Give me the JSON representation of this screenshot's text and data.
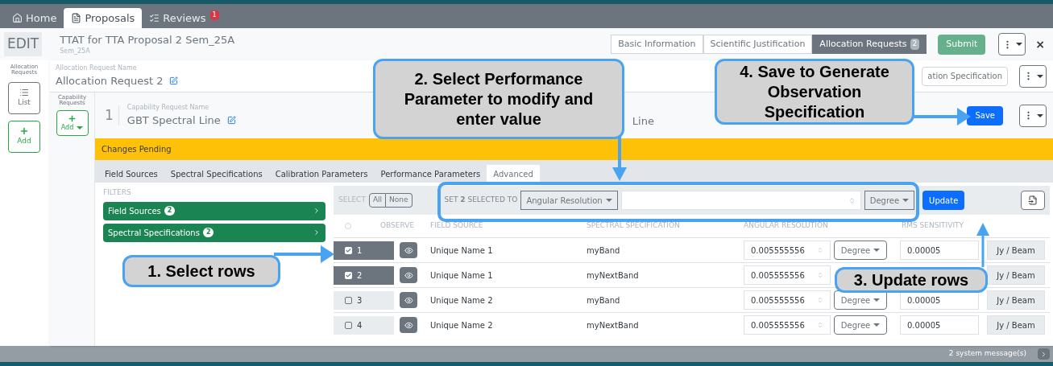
{
  "nav_tabs": [
    {
      "label": "Home",
      "kind": "home",
      "selected": false
    },
    {
      "label": "Proposals",
      "kind": "document",
      "selected": true
    },
    {
      "label": "Reviews",
      "kind": "list",
      "selected": false,
      "badge": "1"
    }
  ],
  "header": {
    "mode": "EDIT",
    "title": "TTAT for TTA Proposal 2 Sem_25A",
    "subtitle": "Sem_25A",
    "sections": [
      {
        "label": "Basic Information",
        "selected": false
      },
      {
        "label": "Scientific Justification",
        "selected": false
      },
      {
        "label": "Allocation Requests",
        "selected": true,
        "badge": "2"
      }
    ],
    "submit": "Submit",
    "close": "×"
  },
  "sidebar": {
    "heading": "Allocation Requests",
    "buttons": [
      {
        "label": "List",
        "kind": "list"
      },
      {
        "label": "Add",
        "kind": "add"
      }
    ]
  },
  "allocation": {
    "label": "Allocation Request Name",
    "value": "Allocation Request 2",
    "spec_button": "ation Specification"
  },
  "capability": {
    "heading": "Capability Requests",
    "add": "Add",
    "index": "1",
    "label": "Capability Request Name",
    "value": "GBT Spectral Line",
    "partial_text": "Line",
    "save": "Save"
  },
  "alert": "Changes Pending",
  "tabs": [
    {
      "label": "Field Sources",
      "selected": false
    },
    {
      "label": "Spectral Specifications",
      "selected": false
    },
    {
      "label": "Calibration Parameters",
      "selected": false
    },
    {
      "label": "Performance Parameters",
      "selected": false
    },
    {
      "label": "Advanced",
      "selected": true
    }
  ],
  "filters": {
    "heading": "FILTERS",
    "items": [
      {
        "label": "Field Sources",
        "count": "2"
      },
      {
        "label": "Spectral Specifications",
        "count": "2"
      }
    ]
  },
  "bulk": {
    "select_label": "SELECT",
    "all": "All",
    "none": "None",
    "set_label": "SET **2** SELECTED TO",
    "parameter": "Angular Resolution",
    "unit": "Degree",
    "update": "Update"
  },
  "table": {
    "all_checked": false,
    "columns": [
      "OBSERVE",
      "FIELD SOURCE",
      "SPECTRAL SPECIFICATION",
      "ANGULAR RESOLUTION",
      "RMS SENSITIVITY"
    ],
    "rows": [
      {
        "number": "1",
        "checked": true,
        "field_source": "Unique Name 1",
        "spectral": "myBand",
        "angular": "0.005555556",
        "unit": "Degree",
        "rms": "0.00005",
        "rms_unit": "Jy / Beam"
      },
      {
        "number": "2",
        "checked": true,
        "field_source": "Unique Name 1",
        "spectral": "myNextBand",
        "angular": "0.005555556",
        "rms_unit": "Jy / Beam"
      },
      {
        "number": "3",
        "checked": false,
        "field_source": "Unique Name 2",
        "spectral": "myBand",
        "angular": "0.005555556",
        "unit": "Degree",
        "rms": "0.00005",
        "rms_unit": "Jy / Beam"
      },
      {
        "number": "4",
        "checked": false,
        "field_source": "Unique Name 2",
        "spectral": "myNextBand",
        "angular": "0.005555556",
        "unit": "Degree",
        "rms": "0.00005",
        "rms_unit": "Jy / Beam"
      }
    ]
  },
  "status_bar": {
    "messages": "2 system message(s)"
  },
  "callouts": [
    {
      "text": "1. Select rows"
    },
    {
      "text": "2. Select Performance Parameter to modify and enter value"
    },
    {
      "text": "3. Update rows"
    },
    {
      "text": "4. Save to Generate Observation Specification"
    }
  ]
}
